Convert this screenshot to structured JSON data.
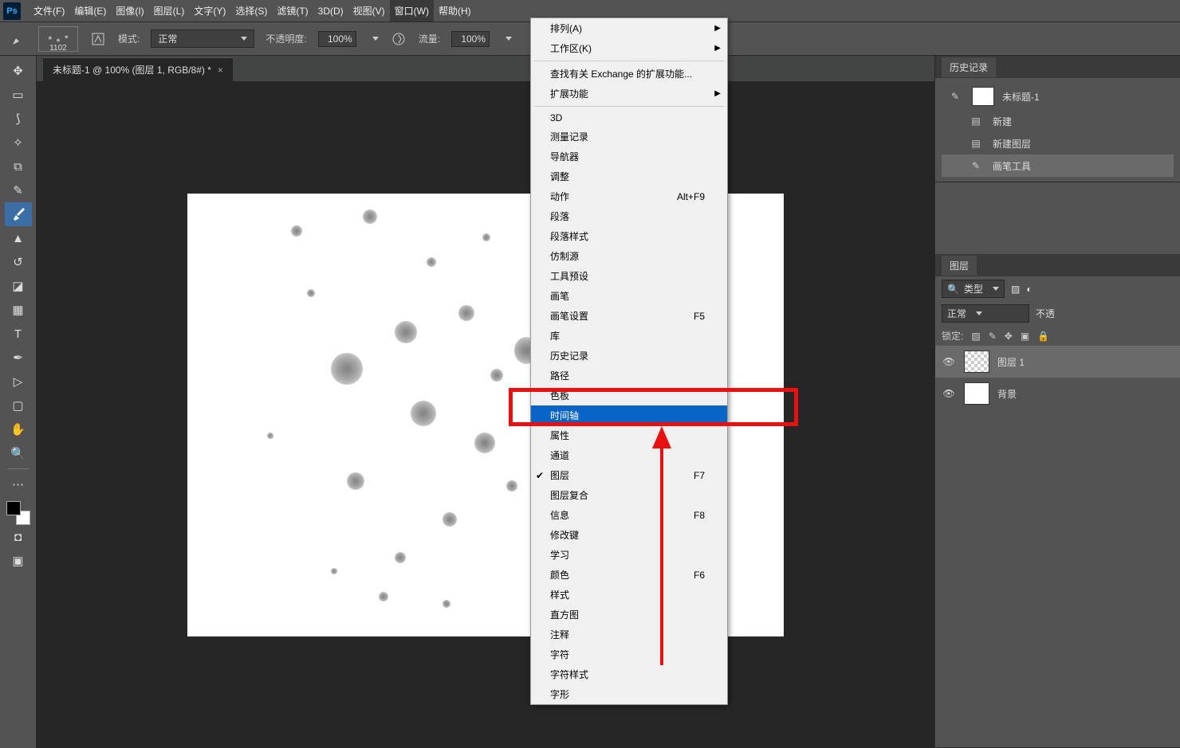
{
  "menubar": {
    "items": [
      "文件(F)",
      "编辑(E)",
      "图像(I)",
      "图层(L)",
      "文字(Y)",
      "选择(S)",
      "滤镜(T)",
      "3D(D)",
      "视图(V)",
      "窗口(W)",
      "帮助(H)"
    ]
  },
  "options": {
    "brush_size": "1102",
    "mode_label": "模式:",
    "mode_value": "正常",
    "opacity_label": "不透明度:",
    "opacity_value": "100%",
    "flow_label": "流量:",
    "flow_value": "100%"
  },
  "document": {
    "tab_title": "未标题-1 @ 100% (图层 1, RGB/8#) *"
  },
  "dropdown": {
    "items": [
      {
        "label": "排列(A)",
        "sub": true
      },
      {
        "label": "工作区(K)",
        "sub": true
      },
      {
        "sep": true
      },
      {
        "label": "查找有关 Exchange 的扩展功能..."
      },
      {
        "label": "扩展功能",
        "sub": true
      },
      {
        "sep": true
      },
      {
        "label": "3D"
      },
      {
        "label": "测量记录"
      },
      {
        "label": "导航器"
      },
      {
        "label": "调整"
      },
      {
        "label": "动作",
        "shortcut": "Alt+F9"
      },
      {
        "label": "段落"
      },
      {
        "label": "段落样式"
      },
      {
        "label": "仿制源"
      },
      {
        "label": "工具预设"
      },
      {
        "label": "画笔"
      },
      {
        "label": "画笔设置",
        "shortcut": "F5"
      },
      {
        "label": "库"
      },
      {
        "label": "历史记录"
      },
      {
        "label": "路径"
      },
      {
        "label": "色板"
      },
      {
        "label": "时间轴",
        "highlighted": true
      },
      {
        "label": "属性"
      },
      {
        "label": "通道"
      },
      {
        "label": "图层",
        "shortcut": "F7",
        "checked": true
      },
      {
        "label": "图层复合"
      },
      {
        "label": "信息",
        "shortcut": "F8"
      },
      {
        "label": "修改键"
      },
      {
        "label": "学习"
      },
      {
        "label": "颜色",
        "shortcut": "F6"
      },
      {
        "label": "样式"
      },
      {
        "label": "直方图"
      },
      {
        "label": "注释"
      },
      {
        "label": "字符"
      },
      {
        "label": "字符样式"
      },
      {
        "label": "字形"
      }
    ]
  },
  "history": {
    "tab": "历史记录",
    "doc": "未标题-1",
    "steps": [
      "新建",
      "新建图层",
      "画笔工具"
    ]
  },
  "layers_panel": {
    "tab": "图层",
    "kind_label": "类型",
    "blend_value": "正常",
    "opacity_label": "不透",
    "lock_label": "锁定:",
    "layers": [
      {
        "name": "图层 1",
        "checker": true,
        "active": true
      },
      {
        "name": "背景",
        "checker": false,
        "active": false
      }
    ]
  }
}
